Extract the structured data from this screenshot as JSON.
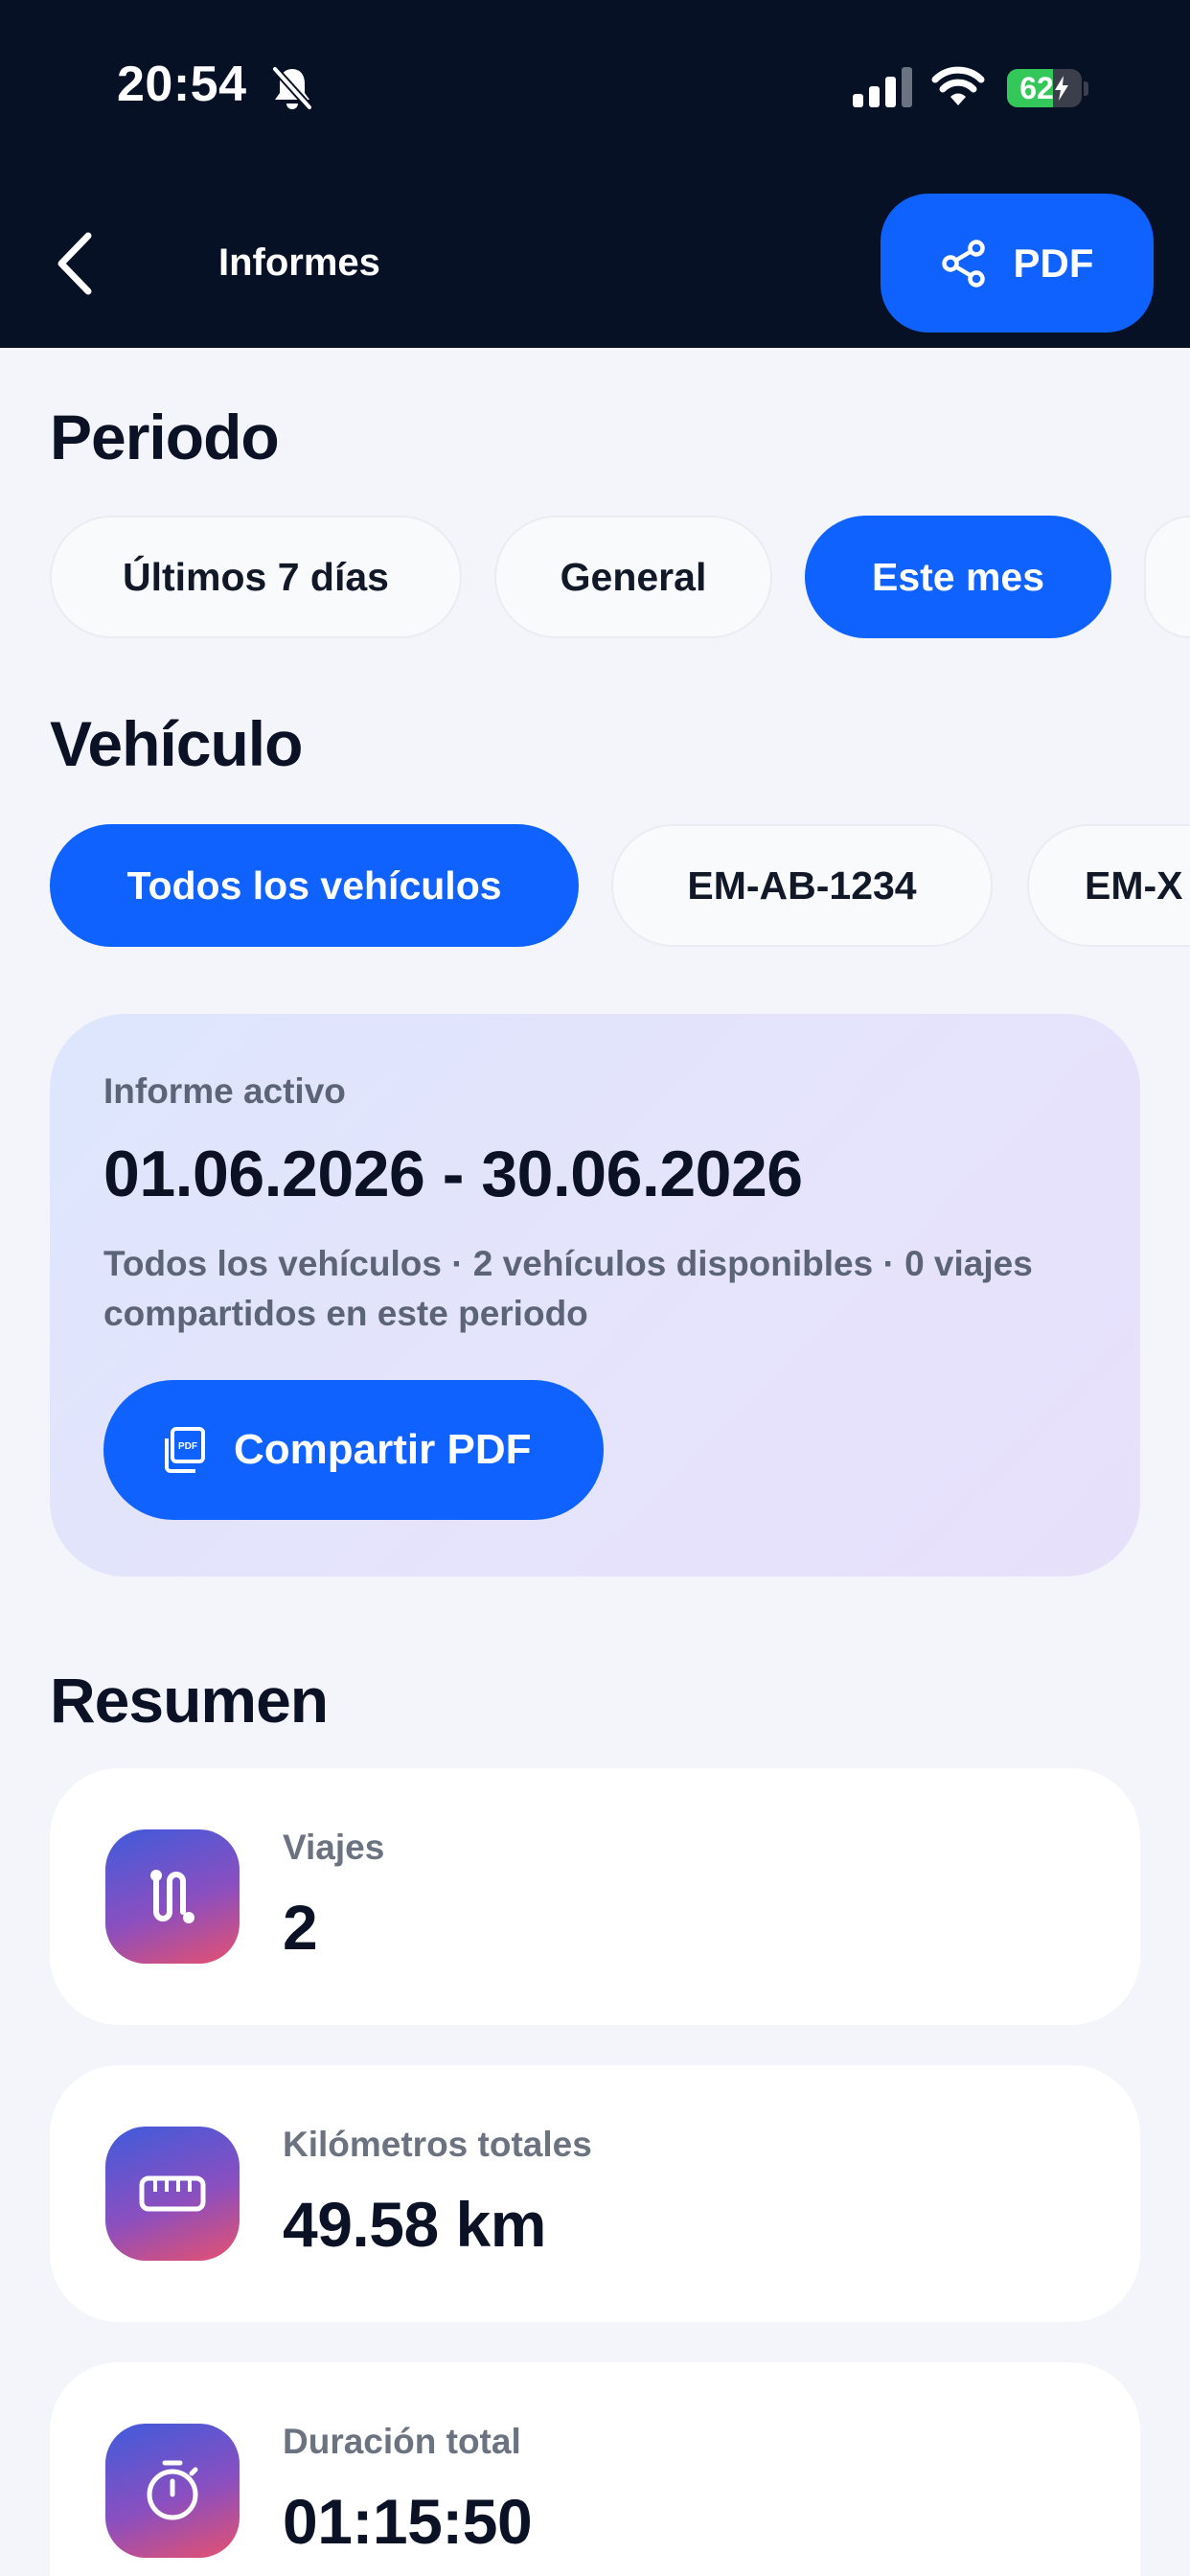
{
  "status_bar": {
    "time": "20:54",
    "battery": "62",
    "battery_level": 0.62
  },
  "header": {
    "title": "Informes",
    "pdf_button": "PDF"
  },
  "periodo": {
    "title": "Periodo",
    "chips": [
      {
        "label": "Últimos 7 días",
        "active": false
      },
      {
        "label": "General",
        "active": false
      },
      {
        "label": "Este mes",
        "active": true
      },
      {
        "label": "",
        "active": false
      }
    ]
  },
  "vehiculo": {
    "title": "Vehículo",
    "chips": [
      {
        "label": "Todos los vehículos",
        "active": true
      },
      {
        "label": "EM-AB-1234",
        "active": false
      },
      {
        "label": "EM-X",
        "active": false
      }
    ]
  },
  "report": {
    "label": "Informe activo",
    "range": "01.06.2026 - 30.06.2026",
    "description": "Todos los vehículos · 2 vehículos disponibles · 0 viajes compartidos en este periodo",
    "share_button": "Compartir PDF"
  },
  "resumen": {
    "title": "Resumen",
    "stats": [
      {
        "label": "Viajes",
        "value": "2",
        "icon": "route-icon"
      },
      {
        "label": "Kilómetros totales",
        "value": "49.58 km",
        "icon": "ruler-icon"
      },
      {
        "label": "Duración total",
        "value": "01:15:50",
        "icon": "stopwatch-icon"
      }
    ]
  },
  "colors": {
    "accent": "#0f62fe",
    "header_bg": "#061126",
    "page_bg": "#f3f5fa",
    "battery": "#34c759"
  }
}
